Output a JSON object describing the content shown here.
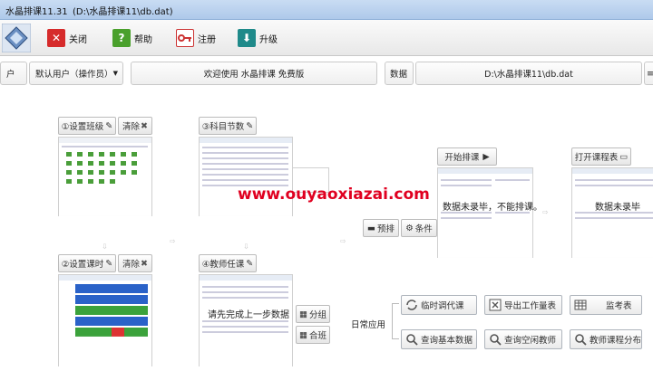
{
  "window": {
    "app_title": "水晶排课11.31",
    "file_path": "(D:\\水晶排课11\\db.dat)"
  },
  "toolbar": {
    "close_label": "关闭",
    "help_label": "帮助",
    "register_label": "注册",
    "upgrade_label": "升级"
  },
  "infobar": {
    "user_label": "户",
    "user_value": "默认用户（操作员）",
    "welcome": "欢迎使用 水晶排课 免费版",
    "data_label": "数据",
    "data_path": "D:\\水晶排课11\\db.dat"
  },
  "steps": {
    "setup_class": "①设置班级",
    "clear_1": "清除",
    "subject_hours": "③科目节数",
    "setup_periods": "②设置课时",
    "clear_2": "清除",
    "teacher_assign": "④教师任课",
    "assign_overlay": "请先完成上一步数据",
    "group": "分组",
    "combine": "合班"
  },
  "schedule": {
    "pre_schedule": "预排",
    "conditions": "条件",
    "start": "开始排课",
    "start_overlay": "数据未录毕，不能排课。",
    "open_table": "打开课程表",
    "open_overlay": "数据未录毕"
  },
  "daily": {
    "label": "日常应用",
    "temp_swap": "临时调代课",
    "export_workload": "导出工作量表",
    "invigilation": "监考表",
    "query_basic": "查询基本数据",
    "query_free_teacher": "查询空闲教师",
    "teacher_distribution": "教师课程分布"
  },
  "watermark": "www.ouyaoxiazai.com",
  "colors": {
    "red": "#d62b2b",
    "green": "#4aa02c",
    "teal": "#1f8a8a",
    "blue": "#2a62c8",
    "watermark": "#e00020"
  }
}
